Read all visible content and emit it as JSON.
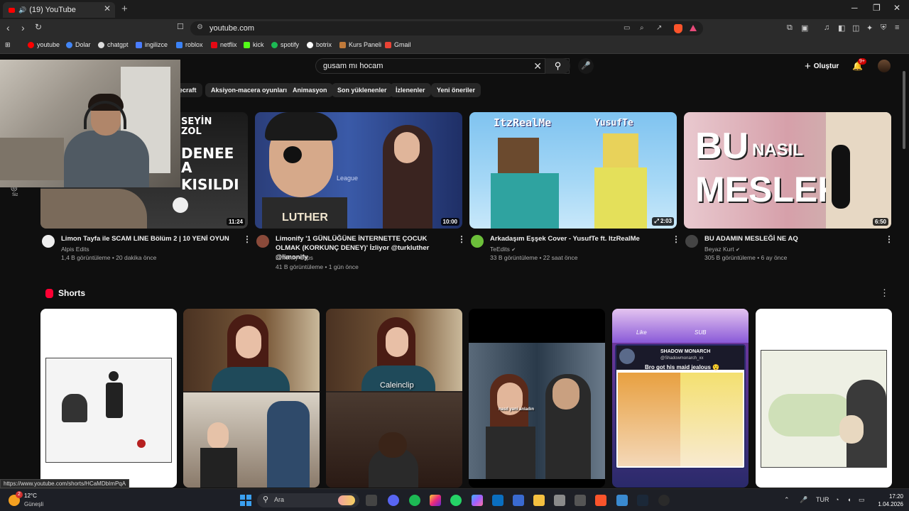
{
  "browser": {
    "tab_title": "(19) YouTube",
    "url": "youtube.com",
    "bookmarks": [
      {
        "label": "youtube",
        "color": "#ff0000"
      },
      {
        "label": "Dolar",
        "color": "#4285f4"
      },
      {
        "label": "chatgpt",
        "color": "#dddddd"
      },
      {
        "label": "ingilizce",
        "color": "#4a7dff"
      },
      {
        "label": "roblox",
        "color": "#3b82f6"
      },
      {
        "label": "netflix",
        "color": "#e50914"
      },
      {
        "label": "kick",
        "color": "#53fc18"
      },
      {
        "label": "spotify",
        "color": "#1db954"
      },
      {
        "label": "botrix",
        "color": "#ffffff"
      },
      {
        "label": "Kurs Paneli",
        "color": "#c07a3a"
      },
      {
        "label": "Gmail",
        "color": "#ea4335"
      }
    ],
    "status_url": "https://www.youtube.com/shorts/HCaMDbImPqA"
  },
  "youtube": {
    "search_value": "gusam mı hocam",
    "create_label": "Oluştur",
    "notif_count": "9+",
    "side_label": "Siz",
    "chips": [
      "ecraft",
      "Aksiyon-macera oyunları",
      "Animasyon",
      "Son yüklenenler",
      "İzlenenler",
      "Yeni öneriler"
    ],
    "videos": [
      {
        "title": "Limon Tayfa ile SCAM LINE Bölüm 2 | 10 YENİ OYUN",
        "channel": "Alpis Edits",
        "meta": "1,4 B görüntüleme • 20 dakika önce",
        "duration": "11:24"
      },
      {
        "title": "Limonify '1 GÜNLÜĞÜNE İNTERNETTE ÇOCUK OLMAK (KORKUNÇ DENEY)' İzliyor @turkluther @limonify",
        "channel": "Limonify Clips",
        "meta": "41 B görüntüleme • 1 gün önce",
        "duration": "10:00"
      },
      {
        "title": "Arkadaşım Eşşek Cover - YusufTe ft. ItzRealMe",
        "channel": "TeEdits",
        "meta": "33 B görüntüleme • 22 saat önce",
        "duration": "2:03"
      },
      {
        "title": "BU ADAMIN MESLEĞİ NE AQ",
        "channel": "Beyaz Kurt",
        "meta": "305 B görüntüleme • 6 ay önce",
        "duration": "6:50"
      }
    ],
    "thumb_text": {
      "v1_line1": "SEYİN",
      "v1_line2": "ZOL",
      "v1_line3": "DENEE",
      "v1_line4": "A KISILDI",
      "v2_name": "LUTHER",
      "v2_league": "League",
      "v3_left": "ItzRealMe",
      "v3_right": "YusufTe",
      "v4_line1": "BU",
      "v4_nasil": "NASIL",
      "v4_line2": "MESLEK?"
    },
    "shorts_title": "Shorts",
    "shorts_text": {
      "s3_caption": "Caleinclip",
      "s4_caption": "nasıl yani anladın",
      "s5_like": "Like",
      "s5_sub": "SUB",
      "s5_user": "SHADOW MONARCH",
      "s5_handle": "@Shadowmonarch_xx",
      "s5_caption": "Bro got his maid jealous 😯"
    }
  },
  "taskbar": {
    "temp": "12°C",
    "condition": "Güneşli",
    "search_label": "Ara",
    "lang": "TUR",
    "time": "17:20",
    "date": "1.04.2026",
    "weather_badge": "2"
  }
}
